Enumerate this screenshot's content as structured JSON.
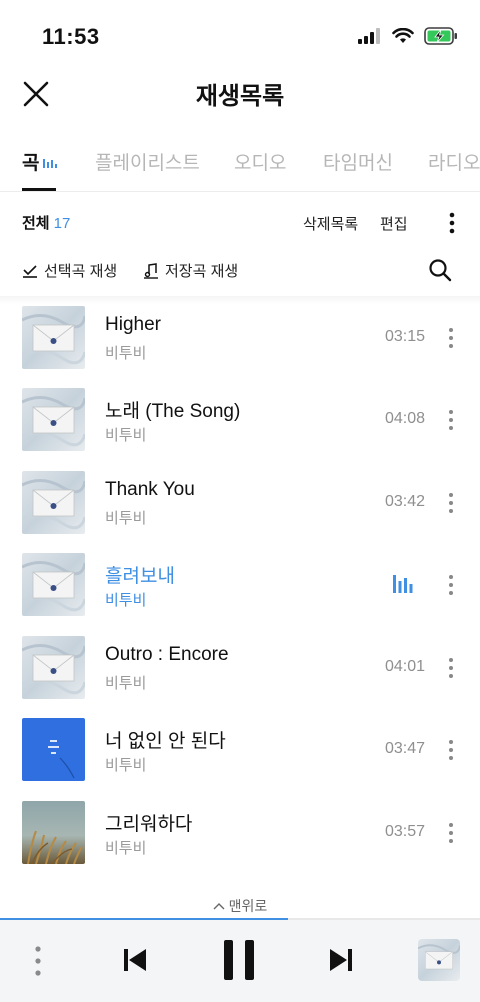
{
  "status_bar": {
    "time": "11:53"
  },
  "nav": {
    "title": "재생목록"
  },
  "tabs": [
    {
      "label": "곡",
      "active": true
    },
    {
      "label": "플레이리스트"
    },
    {
      "label": "오디오"
    },
    {
      "label": "타임머신"
    },
    {
      "label": "라디오"
    }
  ],
  "list_header": {
    "total_label": "전체",
    "total_count": "17",
    "deleted_label": "삭제목록",
    "edit_label": "편집"
  },
  "play_options": {
    "selected_play": "선택곡 재생",
    "saved_play": "저장곡 재생"
  },
  "songs": [
    {
      "title": "Higher",
      "artist": "비투비",
      "duration": "03:15",
      "cover": "envelope-art"
    },
    {
      "title": "노래 (The Song)",
      "artist": "비투비",
      "duration": "04:08",
      "cover": "envelope-art"
    },
    {
      "title": "Thank You",
      "artist": "비투비",
      "duration": "03:42",
      "cover": "envelope-art"
    },
    {
      "title": "흘려보내",
      "artist": "비투비",
      "duration": "",
      "cover": "envelope-art",
      "playing": true
    },
    {
      "title": "Outro : Encore",
      "artist": "비투비",
      "duration": "04:01",
      "cover": "envelope-art"
    },
    {
      "title": "너 없인 안 된다",
      "artist": "비투비",
      "duration": "03:47",
      "cover": "blue-art"
    },
    {
      "title": "그리워하다",
      "artist": "비투비",
      "duration": "03:57",
      "cover": "field-art"
    }
  ],
  "to_top_label": "맨위로",
  "player": {
    "progress": 0.6
  },
  "colors": {
    "accent": "#3f8fe3",
    "text": "#111111",
    "muted": "#9a9a9a",
    "player_bg": "#f4f5f7"
  }
}
